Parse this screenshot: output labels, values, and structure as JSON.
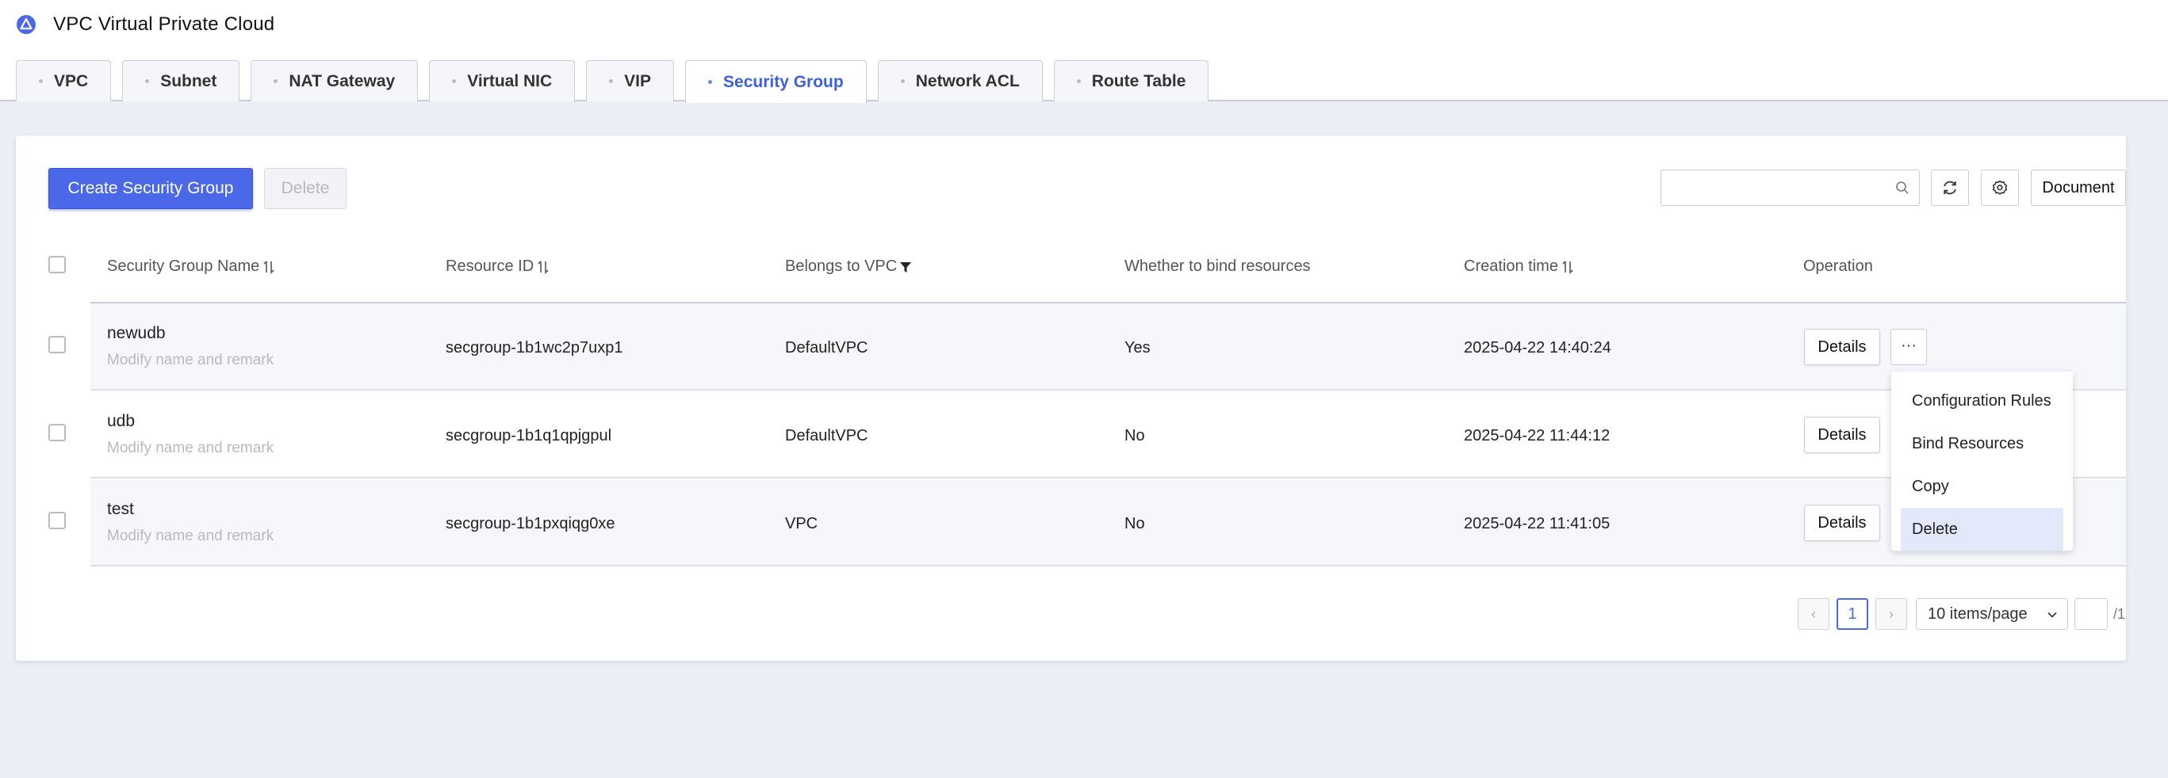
{
  "app": {
    "title": "VPC Virtual Private Cloud",
    "logo_icon": "triangle-logo-icon",
    "accent": "#4b68e8"
  },
  "tabs": [
    {
      "label": "VPC",
      "active": false
    },
    {
      "label": "Subnet",
      "active": false
    },
    {
      "label": "NAT Gateway",
      "active": false
    },
    {
      "label": "Virtual NIC",
      "active": false
    },
    {
      "label": "VIP",
      "active": false
    },
    {
      "label": "Security Group",
      "active": true
    },
    {
      "label": "Network ACL",
      "active": false
    },
    {
      "label": "Route Table",
      "active": false
    }
  ],
  "toolbar": {
    "create_label": "Create Security Group",
    "delete_label": "Delete",
    "search_value": "",
    "search_placeholder": "",
    "document_label": "Document"
  },
  "table": {
    "columns": [
      {
        "label": "Security Group Name",
        "icon": "sort-icon"
      },
      {
        "label": "Resource ID",
        "icon": "sort-icon"
      },
      {
        "label": "Belongs to VPC",
        "icon": "filter-icon"
      },
      {
        "label": "Whether to bind resources",
        "icon": ""
      },
      {
        "label": "Creation time",
        "icon": "sort-icon"
      },
      {
        "label": "Operation",
        "icon": ""
      }
    ],
    "rows": [
      {
        "name": "newudb",
        "remark": "Modify name and remark",
        "resource_id": "secgroup-1b1wc2p7uxp1",
        "vpc": "DefaultVPC",
        "bind": "Yes",
        "created": "2025-04-22 14:40:24",
        "details": "Details",
        "more": "···"
      },
      {
        "name": "udb",
        "remark": "Modify name and remark",
        "resource_id": "secgroup-1b1q1qpjgpul",
        "vpc": "DefaultVPC",
        "bind": "No",
        "created": "2025-04-22 11:44:12",
        "details": "Details"
      },
      {
        "name": "test",
        "remark": "Modify name and remark",
        "resource_id": "secgroup-1b1pxqiqg0xe",
        "vpc": "VPC",
        "bind": "No",
        "created": "2025-04-22 11:41:05",
        "details": "Details"
      }
    ]
  },
  "dropdown": {
    "items": [
      "Configuration Rules",
      "Bind Resources",
      "Copy",
      "Delete"
    ],
    "highlighted": "Delete"
  },
  "pagination": {
    "prev": "‹",
    "current": "1",
    "next": "›",
    "page_size": "10 items/page",
    "jump_value": "",
    "total": "/1"
  }
}
